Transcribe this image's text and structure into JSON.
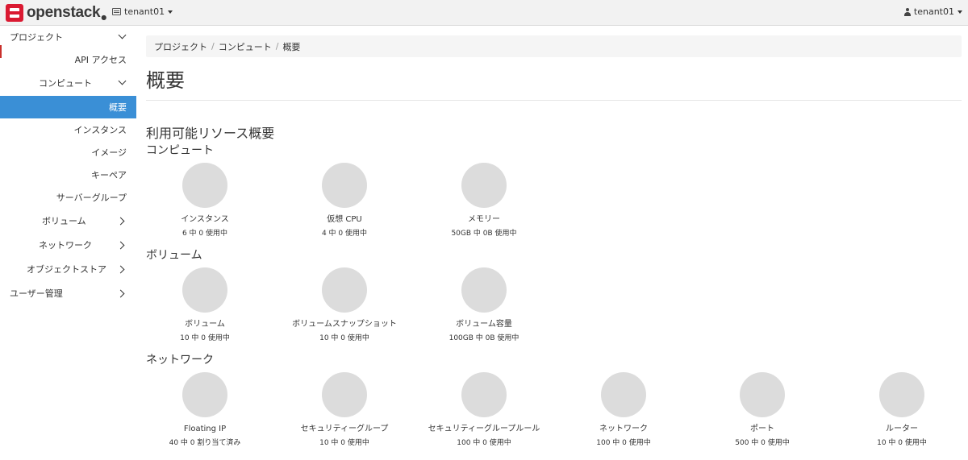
{
  "navbar": {
    "brand": "openstack",
    "project": "tenant01",
    "user": "tenant01"
  },
  "sidebar": {
    "items": [
      {
        "label": "プロジェクト",
        "chevron": "down"
      },
      {
        "label": "API アクセス"
      },
      {
        "label": "コンピュート",
        "chevron": "down"
      },
      {
        "label": "概要",
        "active": true
      },
      {
        "label": "インスタンス"
      },
      {
        "label": "イメージ"
      },
      {
        "label": "キーペア"
      },
      {
        "label": "サーバーグループ"
      },
      {
        "label": "ボリューム",
        "chevron": "right"
      },
      {
        "label": "ネットワーク",
        "chevron": "right"
      },
      {
        "label": "オブジェクトストア",
        "chevron": "right"
      },
      {
        "label": "ユーザー管理",
        "chevron": "right"
      }
    ]
  },
  "breadcrumb": [
    "プロジェクト",
    "コンピュート",
    "概要"
  ],
  "breadcrumb_sep": "/",
  "page_title": "概要",
  "section_title": "利用可能リソース概要",
  "groups": {
    "compute": {
      "title": "コンピュート",
      "charts": [
        {
          "label": "インスタンス",
          "usage": "6 中 0 使用中",
          "used_fraction": 0
        },
        {
          "label": "仮想 CPU",
          "usage": "4 中 0 使用中",
          "used_fraction": 0
        },
        {
          "label": "メモリー",
          "usage": "50GB 中 0B 使用中",
          "used_fraction": 0
        }
      ]
    },
    "volume": {
      "title": "ボリューム",
      "charts": [
        {
          "label": "ボリューム",
          "usage": "10 中 0 使用中",
          "used_fraction": 0
        },
        {
          "label": "ボリュームスナップショット",
          "usage": "10 中 0 使用中",
          "used_fraction": 0
        },
        {
          "label": "ボリューム容量",
          "usage": "100GB 中 0B 使用中",
          "used_fraction": 0
        }
      ]
    },
    "network": {
      "title": "ネットワーク",
      "charts": [
        {
          "label": "Floating IP",
          "usage": "40 中 0 割り当て済み",
          "used_fraction": 0
        },
        {
          "label": "セキュリティーグループ",
          "usage": "10 中 0 使用中",
          "used_fraction": 0
        },
        {
          "label": "セキュリティーグループルール",
          "usage": "100 中 0 使用中",
          "used_fraction": 0
        },
        {
          "label": "ネットワーク",
          "usage": "100 中 0 使用中",
          "used_fraction": 0
        },
        {
          "label": "ポート",
          "usage": "500 中 0 使用中",
          "used_fraction": 0
        },
        {
          "label": "ルーター",
          "usage": "10 中 0 使用中",
          "used_fraction": 0
        }
      ]
    }
  },
  "colors": {
    "active_nav": "#3a8fd6",
    "brand_red": "#da1a32",
    "pie_empty": "#dcdcdc"
  }
}
